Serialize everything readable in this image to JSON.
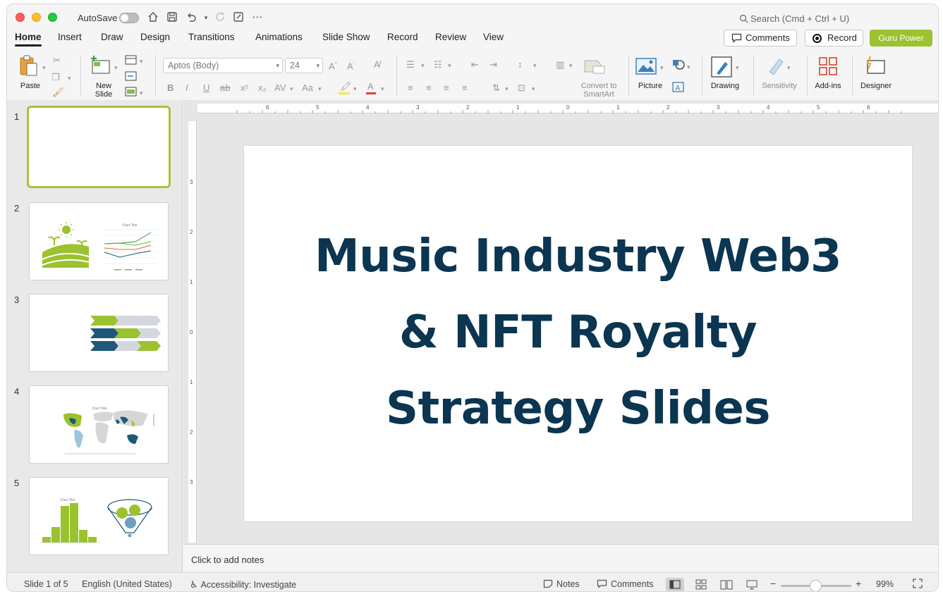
{
  "titlebar": {
    "autosave_label": "AutoSave",
    "search_placeholder": "Search (Cmd + Ctrl + U)"
  },
  "menu": {
    "tabs": [
      "Home",
      "Insert",
      "Draw",
      "Design",
      "Transitions",
      "Animations",
      "Slide Show",
      "Record",
      "Review",
      "View"
    ],
    "active": "Home",
    "comments_label": "Comments",
    "record_label": "Record",
    "guru_label": "Guru Power",
    "guru_color": "#9bc22f"
  },
  "ribbon": {
    "paste_label": "Paste",
    "new_slide_label": "New\nSlide",
    "font_name": "Aptos (Body)",
    "font_size": "24",
    "convert_label": "Convert to\nSmartArt",
    "picture_label": "Picture",
    "drawing_label": "Drawing",
    "sensitivity_label": "Sensitivity",
    "addins_label": "Add-ins",
    "designer_label": "Designer"
  },
  "slides": {
    "numbers": [
      "1",
      "2",
      "3",
      "4",
      "5"
    ],
    "thumb2_chart_title": "Chart Title",
    "thumb4_chart_title": "Chart Title",
    "thumb5_chart_title": "Chart Title"
  },
  "ruler": {
    "h_ticks": [
      "6",
      "5",
      "4",
      "3",
      "2",
      "1",
      "0",
      "1",
      "2",
      "3",
      "4",
      "5",
      "6"
    ],
    "v_ticks": [
      "3",
      "2",
      "1",
      "0",
      "1",
      "2",
      "3"
    ]
  },
  "slide": {
    "title_line1": "Music Industry Web3",
    "title_line2": "& NFT Royalty",
    "title_line3": "Strategy Slides",
    "title_color": "#0b3550"
  },
  "notes": {
    "placeholder": "Click to add notes"
  },
  "status": {
    "slide_counter": "Slide 1 of 5",
    "language": "English (United States)",
    "accessibility": "Accessibility: Investigate",
    "notes_label": "Notes",
    "comments_label": "Comments",
    "zoom": "99%"
  },
  "colors": {
    "accent_green": "#9bc22f",
    "accent_navy": "#1f5878",
    "accent_gray": "#d4d8de"
  }
}
